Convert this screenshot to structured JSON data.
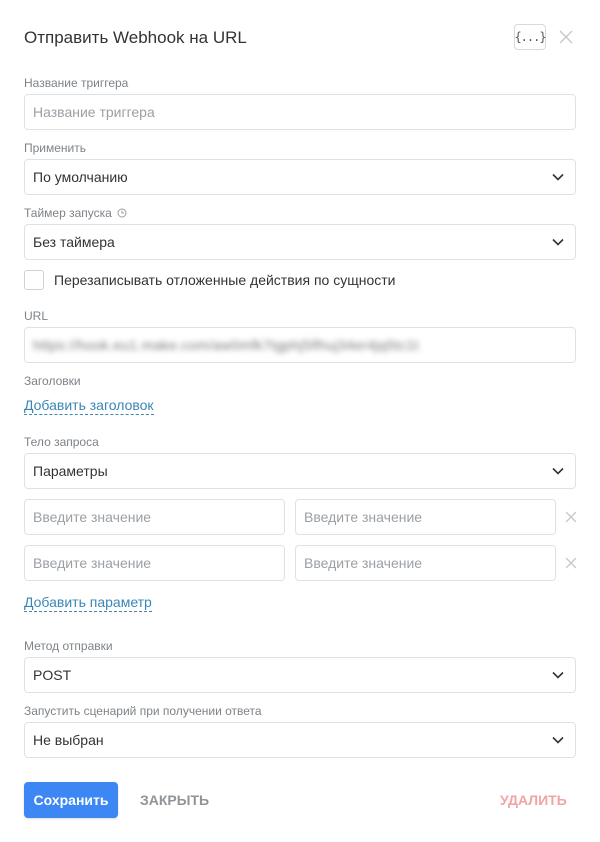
{
  "dialog": {
    "title": "Отправить Webhook на URL",
    "code_button_label": "{...}"
  },
  "form": {
    "trigger_name": {
      "label": "Название триггера",
      "value": "",
      "placeholder": "Название триггера"
    },
    "apply": {
      "label": "Применить",
      "value": "По умолчанию"
    },
    "timer": {
      "label": "Таймер запуска",
      "value": "Без таймера"
    },
    "overwrite": {
      "label": "Перезаписывать отложенные действия по сущности",
      "checked": false
    },
    "url": {
      "label": "URL",
      "value": "https://hook.eu1.make.com/aw0mfk7tgphj5lfhuj34er4jq5tc1t"
    },
    "headers": {
      "label": "Заголовки",
      "add_link": "Добавить заголовок"
    },
    "body": {
      "label": "Тело запроса",
      "value": "Параметры",
      "params": [
        {
          "key": "",
          "value": ""
        },
        {
          "key": "",
          "value": ""
        }
      ],
      "param_placeholder": "Введите значение",
      "add_link": "Добавить параметр"
    },
    "method": {
      "label": "Метод отправки",
      "value": "POST"
    },
    "run_scenario": {
      "label": "Запустить сценарий при получении ответа",
      "value": "Не выбран"
    }
  },
  "actions": {
    "save": "Сохранить",
    "close": "ЗАКРЫТЬ",
    "delete": "УДАЛИТЬ"
  },
  "colors": {
    "primary": "#3d87f5",
    "link": "#3b86b6",
    "danger_muted": "#f2a4a4",
    "label": "#7d8388"
  }
}
